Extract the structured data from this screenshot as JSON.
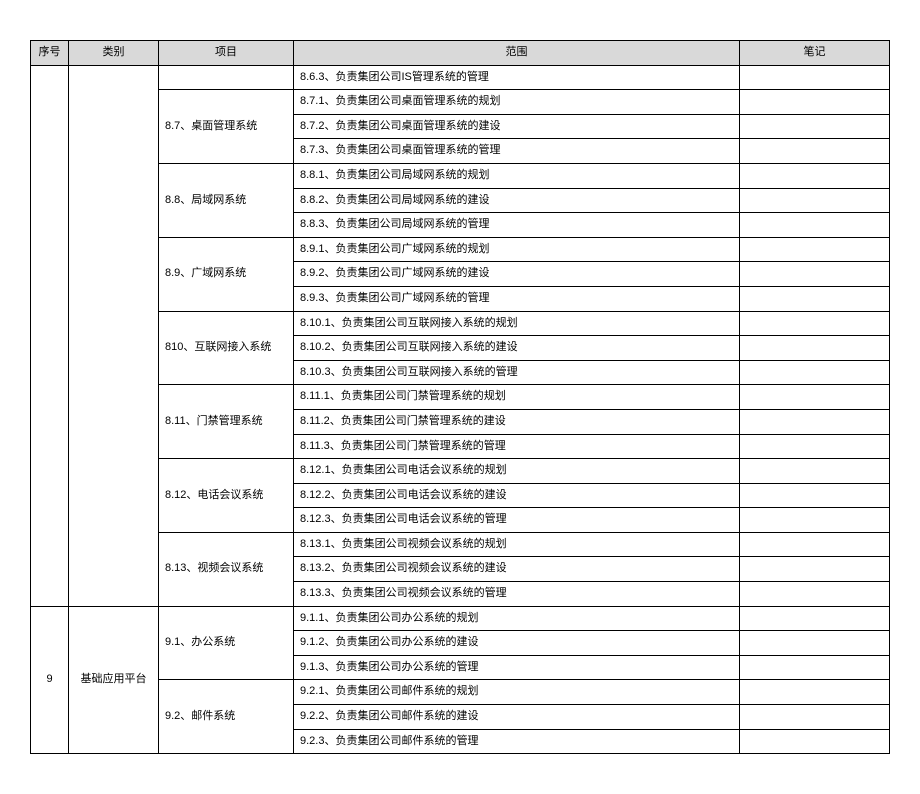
{
  "chart_data": {
    "type": "table",
    "headers": [
      "序号",
      "类别",
      "项目",
      "范围",
      "笔记"
    ],
    "rows": [
      {
        "seq": "",
        "cat": "",
        "proj": "",
        "scope": "8.6.3、负责集团公司IS管理系统的管理",
        "note": ""
      },
      {
        "seq": "",
        "cat": "",
        "proj": "8.7、桌面管理系统",
        "scope": "8.7.1、负责集团公司桌面管理系统的规划",
        "note": ""
      },
      {
        "seq": "",
        "cat": "",
        "proj": "",
        "scope": "8.7.2、负责集团公司桌面管理系统的建设",
        "note": ""
      },
      {
        "seq": "",
        "cat": "",
        "proj": "",
        "scope": "8.7.3、负责集团公司桌面管理系统的管理",
        "note": ""
      },
      {
        "seq": "",
        "cat": "",
        "proj": "8.8、局域网系统",
        "scope": "8.8.1、负责集团公司局域网系统的规划",
        "note": ""
      },
      {
        "seq": "",
        "cat": "",
        "proj": "",
        "scope": "8.8.2、负责集团公司局域网系统的建设",
        "note": ""
      },
      {
        "seq": "",
        "cat": "",
        "proj": "",
        "scope": "8.8.3、负责集团公司局域网系统的管理",
        "note": ""
      },
      {
        "seq": "",
        "cat": "",
        "proj": "8.9、广域网系统",
        "scope": "8.9.1、负责集团公司广域网系统的规划",
        "note": ""
      },
      {
        "seq": "",
        "cat": "",
        "proj": "",
        "scope": "8.9.2、负责集团公司广域网系统的建设",
        "note": ""
      },
      {
        "seq": "",
        "cat": "",
        "proj": "",
        "scope": "8.9.3、负责集团公司广域网系统的管理",
        "note": ""
      },
      {
        "seq": "",
        "cat": "",
        "proj": "810、互联网接入系统",
        "scope": "8.10.1、负责集团公司互联网接入系统的规划",
        "note": ""
      },
      {
        "seq": "",
        "cat": "",
        "proj": "",
        "scope": "8.10.2、负责集团公司互联网接入系统的建设",
        "note": ""
      },
      {
        "seq": "",
        "cat": "",
        "proj": "",
        "scope": "8.10.3、负责集团公司互联网接入系统的管理",
        "note": ""
      },
      {
        "seq": "",
        "cat": "",
        "proj": "8.11、门禁管理系统",
        "scope": "8.11.1、负责集团公司门禁管理系统的规划",
        "note": ""
      },
      {
        "seq": "",
        "cat": "",
        "proj": "",
        "scope": "8.11.2、负责集团公司门禁管理系统的建设",
        "note": ""
      },
      {
        "seq": "",
        "cat": "",
        "proj": "",
        "scope": "8.11.3、负责集团公司门禁管理系统的管理",
        "note": ""
      },
      {
        "seq": "",
        "cat": "",
        "proj": "8.12、电话会议系统",
        "scope": "8.12.1、负责集团公司电话会议系统的规划",
        "note": ""
      },
      {
        "seq": "",
        "cat": "",
        "proj": "",
        "scope": "8.12.2、负责集团公司电话会议系统的建设",
        "note": ""
      },
      {
        "seq": "",
        "cat": "",
        "proj": "",
        "scope": "8.12.3、负责集团公司电话会议系统的管理",
        "note": ""
      },
      {
        "seq": "",
        "cat": "",
        "proj": "8.13、视频会议系统",
        "scope": "8.13.1、负责集团公司视频会议系统的规划",
        "note": ""
      },
      {
        "seq": "",
        "cat": "",
        "proj": "",
        "scope": "8.13.2、负责集团公司视频会议系统的建设",
        "note": ""
      },
      {
        "seq": "",
        "cat": "",
        "proj": "",
        "scope": "8.13.3、负责集团公司视频会议系统的管理",
        "note": ""
      },
      {
        "seq": "9",
        "cat": "基础应用平台",
        "proj": "9.1、办公系统",
        "scope": "9.1.1、负责集团公司办公系统的规划",
        "note": ""
      },
      {
        "seq": "",
        "cat": "",
        "proj": "",
        "scope": "9.1.2、负责集团公司办公系统的建设",
        "note": ""
      },
      {
        "seq": "",
        "cat": "",
        "proj": "",
        "scope": "9.1.3、负责集团公司办公系统的管理",
        "note": ""
      },
      {
        "seq": "",
        "cat": "",
        "proj": "9.2、邮件系统",
        "scope": "9.2.1、负责集团公司邮件系统的规划",
        "note": ""
      },
      {
        "seq": "",
        "cat": "",
        "proj": "",
        "scope": "9.2.2、负责集团公司邮件系统的建设",
        "note": ""
      },
      {
        "seq": "",
        "cat": "",
        "proj": "",
        "scope": "9.2.3、负责集团公司邮件系统的管理",
        "note": ""
      }
    ]
  },
  "headers": {
    "h0": "序号",
    "h1": "类别",
    "h2": "项目",
    "h3": "范围",
    "h4": "笔记"
  },
  "projects": {
    "p87": "8.7、桌面管理系统",
    "p88": "8.8、局域网系统",
    "p89": "8.9、广域网系统",
    "p810": "810、互联网接入系统",
    "p811": "8.11、门禁管理系统",
    "p812": "8.12、电话会议系统",
    "p813": "8.13、视频会议系统",
    "p91": "9.1、办公系统",
    "p92": "9.2、邮件系统"
  },
  "scopes": {
    "s863": "8.6.3、负责集团公司IS管理系统的管理",
    "s871": "8.7.1、负责集团公司桌面管理系统的规划",
    "s872": "8.7.2、负责集团公司桌面管理系统的建设",
    "s873": "8.7.3、负责集团公司桌面管理系统的管理",
    "s881": "8.8.1、负责集团公司局域网系统的规划",
    "s882": "8.8.2、负责集团公司局域网系统的建设",
    "s883": "8.8.3、负责集团公司局域网系统的管理",
    "s891": "8.9.1、负责集团公司广域网系统的规划",
    "s892": "8.9.2、负责集团公司广域网系统的建设",
    "s893": "8.9.3、负责集团公司广域网系统的管理",
    "s8101": "8.10.1、负责集团公司互联网接入系统的规划",
    "s8102": "8.10.2、负责集团公司互联网接入系统的建设",
    "s8103": "8.10.3、负责集团公司互联网接入系统的管理",
    "s8111": "8.11.1、负责集团公司门禁管理系统的规划",
    "s8112": "8.11.2、负责集团公司门禁管理系统的建设",
    "s8113": "8.11.3、负责集团公司门禁管理系统的管理",
    "s8121": "8.12.1、负责集团公司电话会议系统的规划",
    "s8122": "8.12.2、负责集团公司电话会议系统的建设",
    "s8123": "8.12.3、负责集团公司电话会议系统的管理",
    "s8131": "8.13.1、负责集团公司视频会议系统的规划",
    "s8132": "8.13.2、负责集团公司视频会议系统的建设",
    "s8133": "8.13.3、负责集团公司视频会议系统的管理",
    "s911": "9.1.1、负责集团公司办公系统的规划",
    "s912": "9.1.2、负责集团公司办公系统的建设",
    "s913": "9.1.3、负责集团公司办公系统的管理",
    "s921": "9.2.1、负责集团公司邮件系统的规划",
    "s922": "9.2.2、负责集团公司邮件系统的建设",
    "s923": "9.2.3、负责集团公司邮件系统的管理"
  },
  "seq": {
    "r9": "9"
  },
  "cat": {
    "r9": "基础应用平台"
  }
}
